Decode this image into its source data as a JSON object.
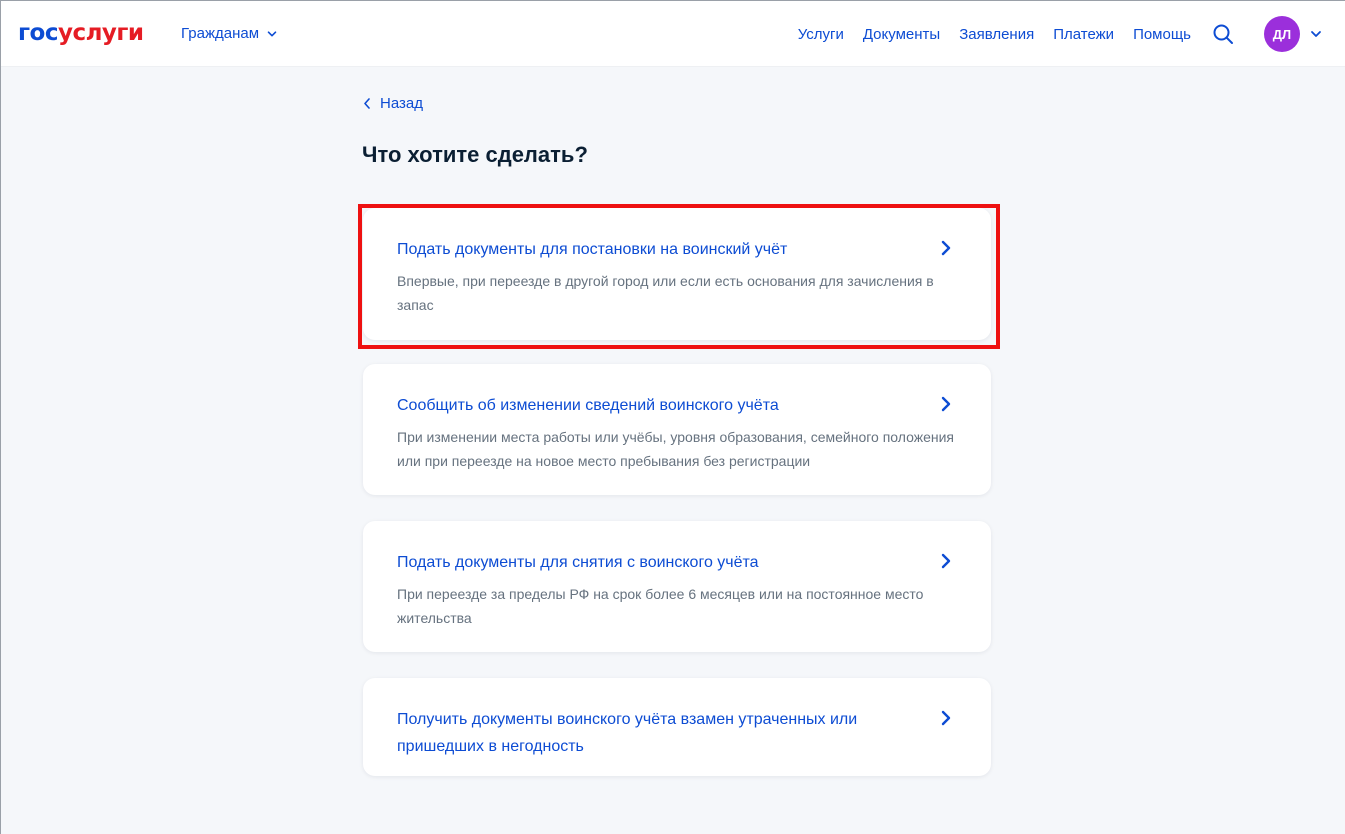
{
  "header": {
    "logo_part1": "гос",
    "logo_part2": "услуги",
    "audience_label": "Гражданам",
    "nav": [
      "Услуги",
      "Документы",
      "Заявления",
      "Платежи",
      "Помощь"
    ],
    "avatar_initials": "ДЛ"
  },
  "back_label": "Назад",
  "page_title": "Что хотите сделать?",
  "cards": [
    {
      "title": "Подать документы для постановки на воинский учёт",
      "description": "Впервые, при переезде в другой город или если есть основания для зачисления в запас"
    },
    {
      "title": "Сообщить об изменении сведений воинского учёта",
      "description": "При изменении места работы или учёбы, уровня образования, семейного положения или при переезде на новое место пребывания без регистрации"
    },
    {
      "title": "Подать документы для снятия с воинского учёта",
      "description": "При переезде за пределы РФ на срок более 6 месяцев или на постоянное место жительства"
    },
    {
      "title": "Получить документы воинского учёта взамен утраченных или пришедших в негодность",
      "description": ""
    }
  ],
  "colors": {
    "brand_blue": "#0d4cd3",
    "brand_red": "#e51c24",
    "avatar": "#9b2fdb",
    "highlight": "#ee1111",
    "background": "#f5f7fa"
  },
  "icons": [
    "chevron-down-icon",
    "search-icon",
    "chevron-left-icon",
    "chevron-right-icon"
  ]
}
